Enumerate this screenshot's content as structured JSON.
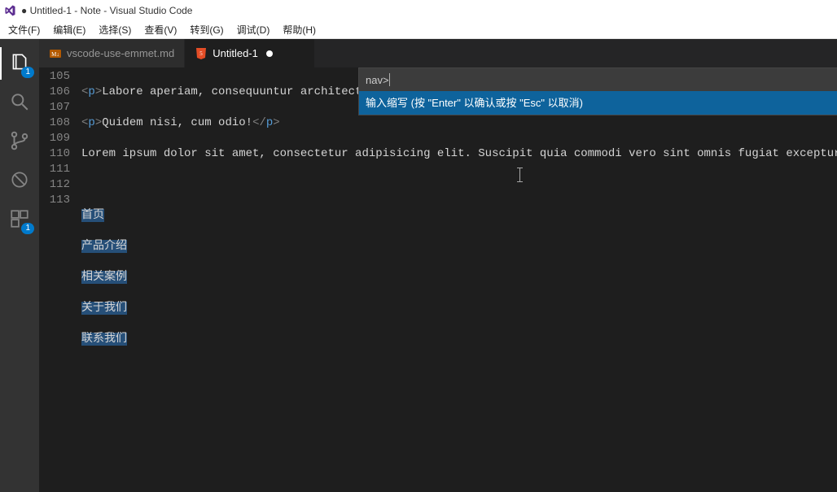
{
  "window": {
    "title": "● Untitled-1 - Note - Visual Studio Code"
  },
  "menu": {
    "file": "文件(F)",
    "edit": "编辑(E)",
    "select": "选择(S)",
    "view": "查看(V)",
    "goto": "转到(G)",
    "debug": "调试(D)",
    "help": "帮助(H)"
  },
  "activity": {
    "explorer_badge": "1",
    "debug_badge": "1"
  },
  "tabs": {
    "t1": {
      "label": "vscode-use-emmet.md"
    },
    "t2": {
      "label": "Untitled-1"
    }
  },
  "gutter": {
    "l105": "105",
    "l106": "106",
    "l107": "107",
    "l108": "108",
    "l109": "109",
    "l110": "110",
    "l111": "111",
    "l112": "112",
    "l113": "113"
  },
  "code": {
    "l105_open": "<",
    "l105_p": "p",
    "l105_close": ">",
    "l105_text": "Labore aperiam, consequuntur architecto",
    "l106_open": "<",
    "l106_p": "p",
    "l106_close": ">",
    "l106_text": "Quidem nisi, cum odio!",
    "l106_end_open": "</",
    "l106_end_p": "p",
    "l106_end_close": ">",
    "l107": "Lorem ipsum dolor sit amet, consectetur adipisicing elit. Suscipit quia commodi vero sint omnis fugiat excepturi reicie",
    "l109": "首页",
    "l110": "产品介绍",
    "l111": "相关案例",
    "l112": "关于我们",
    "l113": "联系我们"
  },
  "popup": {
    "input_value": "nav>",
    "hint": "输入缩写 (按 \"Enter\" 以确认或按 \"Esc\" 以取消)"
  }
}
